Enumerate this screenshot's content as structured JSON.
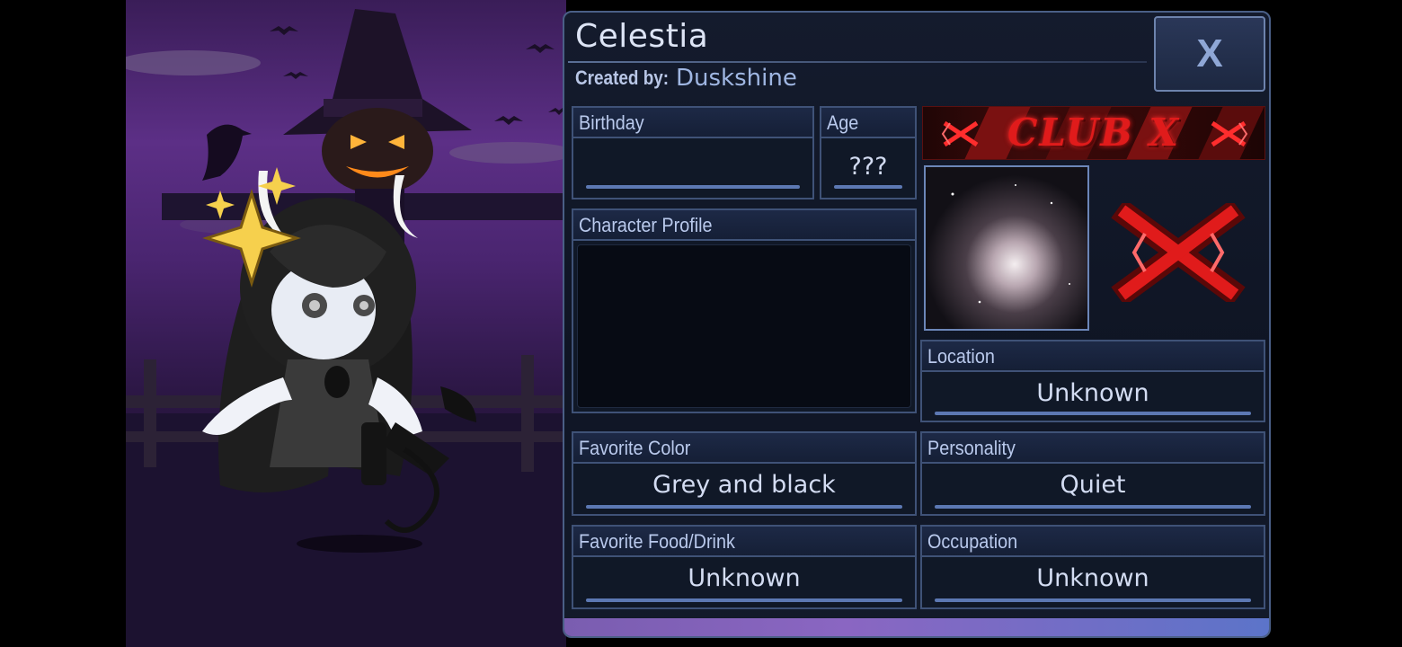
{
  "character": {
    "name": "Celestia",
    "created_by_label": "Created by:",
    "created_by": "Duskshine"
  },
  "close_button": {
    "label": "X"
  },
  "fields": {
    "birthday": {
      "label": "Birthday",
      "value": ""
    },
    "age": {
      "label": "Age",
      "value": "???"
    },
    "profile": {
      "label": "Character Profile",
      "value": ""
    },
    "location": {
      "label": "Location",
      "value": "Unknown"
    },
    "favorite_color": {
      "label": "Favorite Color",
      "value": "Grey and black"
    },
    "personality": {
      "label": "Personality",
      "value": "Quiet"
    },
    "favorite_food": {
      "label": "Favorite Food/Drink",
      "value": "Unknown"
    },
    "occupation": {
      "label": "Occupation",
      "value": "Unknown"
    }
  },
  "banner": {
    "text": "CLUB X"
  },
  "colors": {
    "panel_bg": "#141b2d",
    "panel_border": "#4a5f86",
    "label_text": "#b9c9ec",
    "value_text": "#d3dcf2",
    "accent_red": "#e01b1b",
    "underline": "#5c78b3",
    "bottom_strip": "#8a66c2"
  }
}
